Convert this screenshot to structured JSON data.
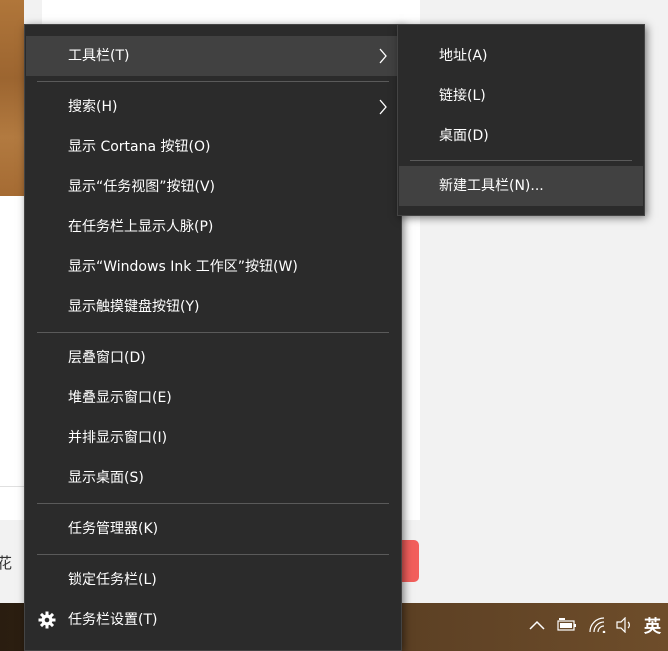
{
  "background": {
    "partial_text": "花"
  },
  "context_menu": {
    "items": [
      {
        "label": "工具栏(T)"
      },
      {
        "label": "搜索(H)"
      },
      {
        "label": "显示 Cortana 按钮(O)"
      },
      {
        "label": "显示“任务视图”按钮(V)"
      },
      {
        "label": "在任务栏上显示人脉(P)"
      },
      {
        "label": "显示“Windows Ink 工作区”按钮(W)"
      },
      {
        "label": "显示触摸键盘按钮(Y)"
      },
      {
        "label": "层叠窗口(D)"
      },
      {
        "label": "堆叠显示窗口(E)"
      },
      {
        "label": "并排显示窗口(I)"
      },
      {
        "label": "显示桌面(S)"
      },
      {
        "label": "任务管理器(K)"
      },
      {
        "label": "锁定任务栏(L)"
      },
      {
        "label": "任务栏设置(T)"
      }
    ]
  },
  "submenu": {
    "items": [
      {
        "label": "地址(A)"
      },
      {
        "label": "链接(L)"
      },
      {
        "label": "桌面(D)"
      },
      {
        "label": "新建工具栏(N)..."
      }
    ]
  },
  "tray": {
    "ime_label": "英",
    "icons": [
      "chevron-up-icon",
      "battery-icon",
      "wifi-icon",
      "volume-icon"
    ]
  },
  "colors": {
    "menu_bg": "#2b2b2b",
    "highlight": "#414141",
    "separator": "#5a5a5a"
  }
}
